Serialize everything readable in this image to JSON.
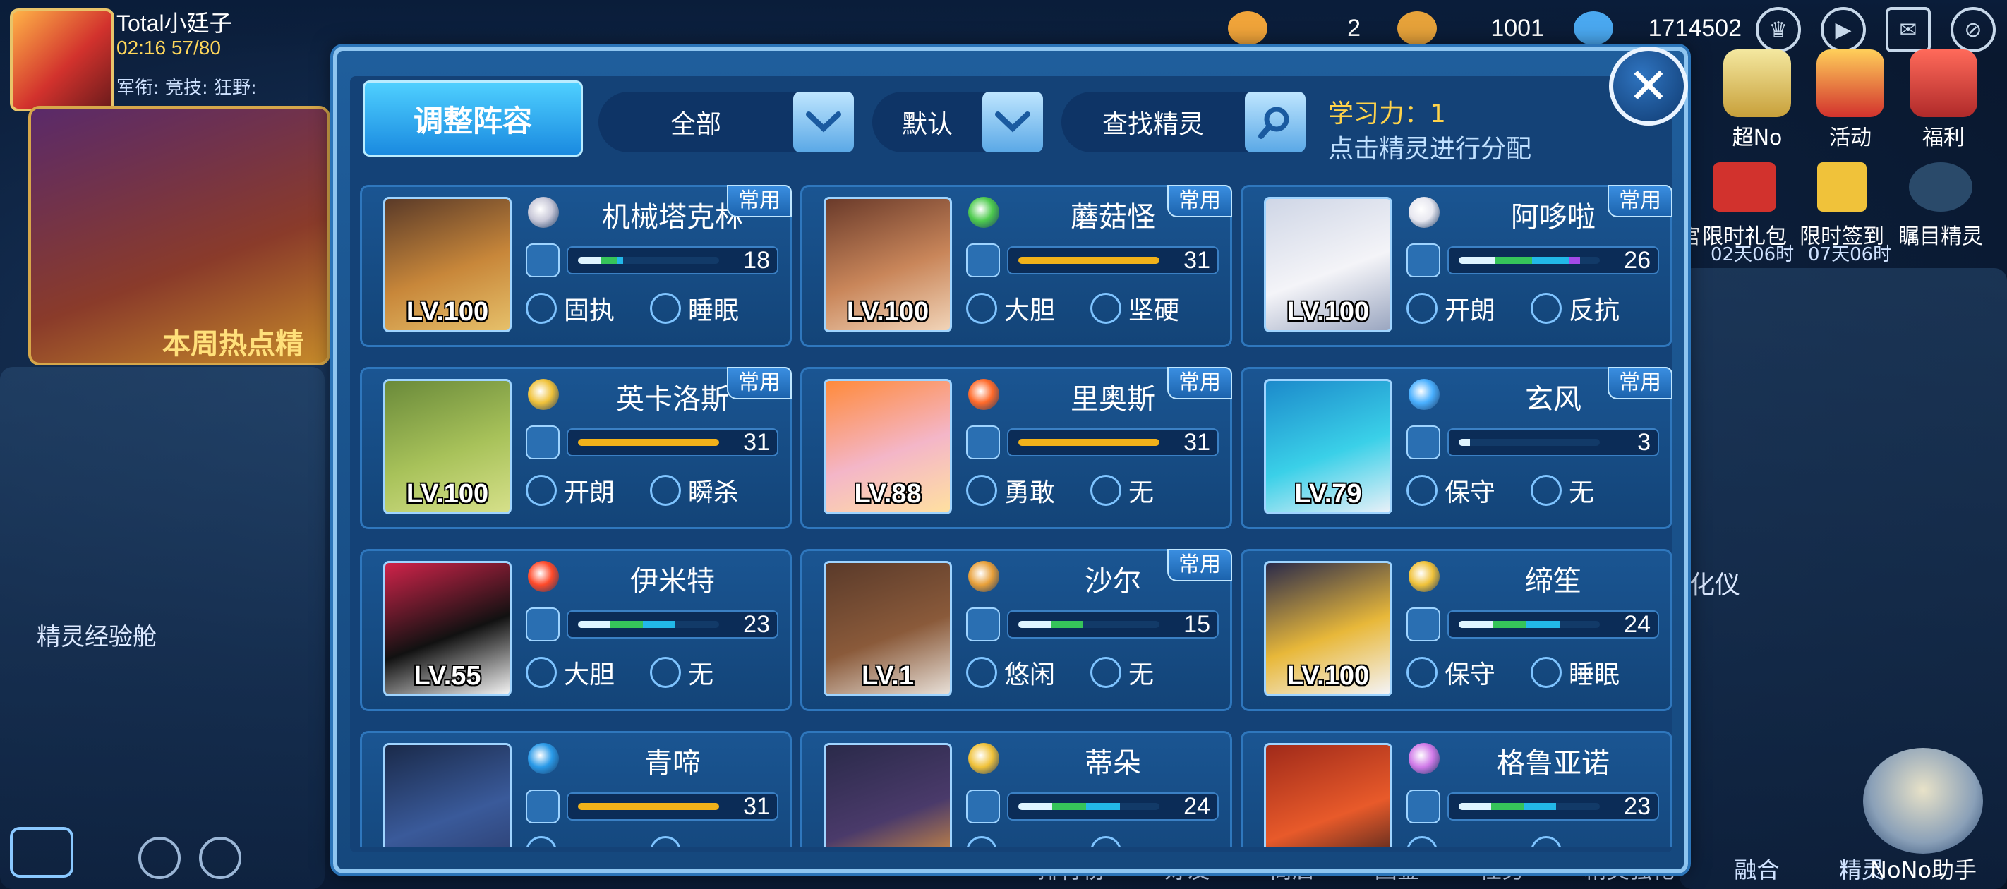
{
  "player": {
    "name": "Total小廷子",
    "energy": "02:16 57/80",
    "ranks": "军衔:    竞技:     狂野:"
  },
  "resources": [
    {
      "name": "stamina-item",
      "value": "2",
      "color": "#f0a43a"
    },
    {
      "name": "gold",
      "value": "1001",
      "color": "#e6a23a"
    },
    {
      "name": "diamond",
      "value": "1714502",
      "color": "#4aa8f0"
    }
  ],
  "top_icons": [
    "trophy-icon",
    "play-icon",
    "mail-icon",
    "hide-icon"
  ],
  "background": {
    "banner_text": "本周热点精",
    "left_label": "精灵经验舱",
    "right_label": "化仪",
    "right_menu": [
      "超No",
      "活动",
      "福利"
    ],
    "right_menu_partial": "",
    "events": [
      "限时礼包",
      "限时签到",
      "瞩目精灵"
    ],
    "event_prefix": "宫",
    "event_times": [
      "02天06时",
      "07天06时"
    ],
    "bottom_tabs": [
      "排行榜",
      "好友",
      "商店",
      "图鉴",
      "任务",
      "精灵强化",
      "融合",
      "精灵"
    ],
    "nono_label": "NoNo助手"
  },
  "modal": {
    "title_tab": "调整阵容",
    "filter_type": "全部",
    "filter_sort": "默认",
    "search_label": "查找精灵",
    "learning_power": "学习力：1",
    "hint": "点击精灵进行分配",
    "close": "✕"
  },
  "badge_label": "常用",
  "pets": [
    {
      "name": "机械塔克林",
      "level": "LV.100",
      "value": "18",
      "trait1": "固执",
      "trait2": "睡眠",
      "badge": true,
      "fill": [
        0.16,
        0.12,
        0.04,
        0
      ],
      "element_color": "#c8c8d8",
      "portrait": [
        "#5a3a28",
        "#c8873a",
        "#e6c06a"
      ]
    },
    {
      "name": "蘑菇怪",
      "level": "LV.100",
      "value": "31",
      "trait1": "大胆",
      "trait2": "坚硬",
      "badge": true,
      "fill": [
        1,
        0,
        0,
        0
      ],
      "element_color": "#4ecb4e",
      "portrait": [
        "#6a3a2a",
        "#c9865a",
        "#f1d4b8"
      ]
    },
    {
      "name": "阿哆啦",
      "level": "LV.100",
      "value": "26",
      "trait1": "开朗",
      "trait2": "反抗",
      "badge": true,
      "fill": [
        0.26,
        0.26,
        0.26,
        0.08
      ],
      "element_color": "#e8e8f0",
      "portrait": [
        "#cfd6e6",
        "#f4f4f8",
        "#9aa6c0"
      ]
    },
    {
      "name": "英卡洛斯",
      "level": "LV.100",
      "value": "31",
      "trait1": "开朗",
      "trait2": "瞬杀",
      "badge": true,
      "fill": [
        1,
        0,
        0,
        0
      ],
      "element_color": "#f0c23a",
      "portrait": [
        "#6a8a3a",
        "#a8c25a",
        "#d6e08a"
      ]
    },
    {
      "name": "里奥斯",
      "level": "LV.88",
      "value": "31",
      "trait1": "勇敢",
      "trait2": "无",
      "badge": true,
      "fill": [
        1,
        0,
        0,
        0
      ],
      "element_color": "#ff6a2a",
      "portrait": [
        "#ff8a3a",
        "#f4b6c8",
        "#ffe0a0"
      ]
    },
    {
      "name": "玄风",
      "level": "LV.79",
      "value": "3",
      "trait1": "保守",
      "trait2": "无",
      "badge": true,
      "fill": [
        0.08,
        0,
        0,
        0
      ],
      "element_color": "#4ab0ff",
      "portrait": [
        "#1c8acb",
        "#3ad0e8",
        "#e8f0f8"
      ]
    },
    {
      "name": "伊米特",
      "level": "LV.55",
      "value": "23",
      "trait1": "大胆",
      "trait2": "无",
      "badge": false,
      "fill": [
        0.23,
        0.23,
        0.23,
        0
      ],
      "element_color": "#ff4a2a",
      "portrait": [
        "#d0234a",
        "#111111",
        "#f4f4f4"
      ]
    },
    {
      "name": "沙尔",
      "level": "LV.1",
      "value": "15",
      "trait1": "悠闲",
      "trait2": "无",
      "badge": true,
      "fill": [
        0.23,
        0.23,
        0,
        0
      ],
      "element_color": "#e8a03a",
      "portrait": [
        "#5a3a2a",
        "#8a5a3a",
        "#e8e0d8"
      ]
    },
    {
      "name": "缔笙",
      "level": "LV.100",
      "value": "24",
      "trait1": "保守",
      "trait2": "睡眠",
      "badge": false,
      "fill": [
        0.24,
        0.24,
        0.24,
        0
      ],
      "element_color": "#f0c23a",
      "portrait": [
        "#2a2a4a",
        "#e8b83a",
        "#f4f4f8"
      ]
    },
    {
      "name": "青啼",
      "level": "",
      "value": "31",
      "trait1": "",
      "trait2": "",
      "badge": false,
      "fill": [
        1,
        0,
        0,
        0
      ],
      "element_color": "#2a9ae8",
      "portrait": [
        "#1a2a4a",
        "#3a5a9a",
        "#2a3a6a"
      ]
    },
    {
      "name": "蒂朵",
      "level": "",
      "value": "24",
      "trait1": "",
      "trait2": "",
      "badge": false,
      "fill": [
        0.24,
        0.24,
        0.24,
        0
      ],
      "element_color": "#f0c23a",
      "portrait": [
        "#2a2a4a",
        "#4a3a6a",
        "#f0a03a"
      ]
    },
    {
      "name": "格鲁亚诺",
      "level": "",
      "value": "23",
      "trait1": "",
      "trait2": "",
      "badge": false,
      "fill": [
        0.23,
        0.23,
        0.23,
        0
      ],
      "element_color": "#d07ae8",
      "portrait": [
        "#a02a1a",
        "#e85a2a",
        "#2a1a1a"
      ]
    }
  ],
  "bar_colors": [
    "#dff4ff",
    "#36c45a",
    "#22b8e8",
    "#a24ae8"
  ],
  "full_bar_color": "#f2b21a"
}
